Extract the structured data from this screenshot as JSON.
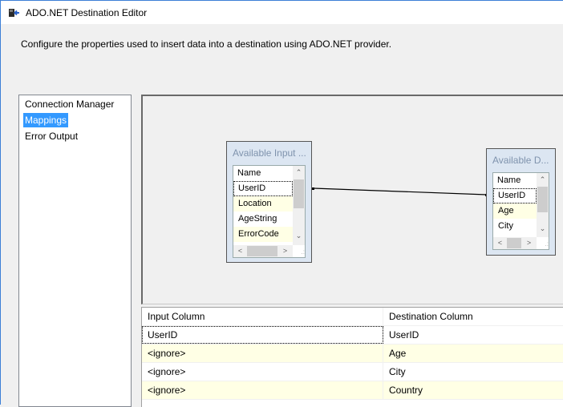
{
  "window": {
    "title": "ADO.NET Destination Editor",
    "icon": "ado-net-destination-icon",
    "accent_color": "#3c7fd6"
  },
  "description": "Configure the properties used to insert data into a destination using ADO.NET provider.",
  "nav": {
    "items": [
      {
        "label": "Connection Manager",
        "selected": false
      },
      {
        "label": "Mappings",
        "selected": true
      },
      {
        "label": "Error Output",
        "selected": false
      }
    ],
    "selected_color": "#3399ff"
  },
  "mapping_canvas": {
    "input_table": {
      "caption": "Available Input ...",
      "header": "Name",
      "rows": [
        {
          "label": "UserID",
          "focused": true,
          "highlighted": false
        },
        {
          "label": "Location",
          "focused": false,
          "highlighted": true
        },
        {
          "label": "AgeString",
          "focused": false,
          "highlighted": false
        },
        {
          "label": "ErrorCode",
          "focused": false,
          "highlighted": true
        }
      ]
    },
    "destination_table": {
      "caption": "Available D...",
      "header": "Name",
      "rows": [
        {
          "label": "UserID",
          "focused": true,
          "highlighted": false
        },
        {
          "label": "Age",
          "focused": false,
          "highlighted": true
        },
        {
          "label": "City",
          "focused": false,
          "highlighted": false
        }
      ]
    },
    "mapping_line": {
      "from": "UserID",
      "to": "UserID"
    },
    "scroll_icons": {
      "up": "▲",
      "down": "▼",
      "left": "<",
      "right": ">",
      "grip": "⋰"
    }
  },
  "grid": {
    "columns": [
      "Input Column",
      "Destination Column"
    ],
    "rows": [
      {
        "input": "UserID",
        "destination": "UserID"
      },
      {
        "input": "<ignore>",
        "destination": "Age"
      },
      {
        "input": "<ignore>",
        "destination": "City"
      },
      {
        "input": "<ignore>",
        "destination": "Country"
      }
    ]
  }
}
